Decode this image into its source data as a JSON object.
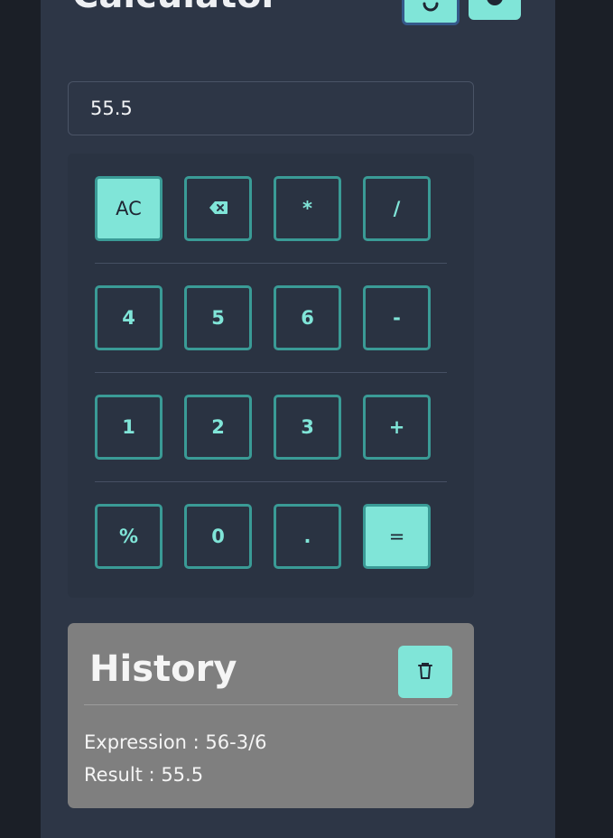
{
  "header": {
    "title": "Calculator",
    "history_toggle_icon": "history-icon",
    "theme_toggle_icon": "moon-icon"
  },
  "display": {
    "value": "55.5"
  },
  "keypad": {
    "rows": [
      [
        "AC",
        "backspace",
        "*",
        "/"
      ],
      [
        "4",
        "5",
        "6",
        "-"
      ],
      [
        "1",
        "2",
        "3",
        "+"
      ],
      [
        "%",
        "0",
        ".",
        "="
      ]
    ],
    "labels": {
      "ac": "AC",
      "multiply": "*",
      "divide": "/",
      "four": "4",
      "five": "5",
      "six": "6",
      "minus": "-",
      "one": "1",
      "two": "2",
      "three": "3",
      "plus": "+",
      "percent": "%",
      "zero": "0",
      "dot": ".",
      "equals": "="
    },
    "backspace_icon": "backspace-icon"
  },
  "history": {
    "title": "History",
    "clear_icon": "trash-icon",
    "entries": [
      {
        "expression_line": "Expression : 56-3/6",
        "result_line": "Result : 55.5"
      }
    ]
  },
  "colors": {
    "accent": "#80e5d8",
    "key_border": "#3a9b96",
    "panel_bg": "#2d3646",
    "page_bg": "#1b1f27",
    "history_bg": "#7f7f7f"
  }
}
